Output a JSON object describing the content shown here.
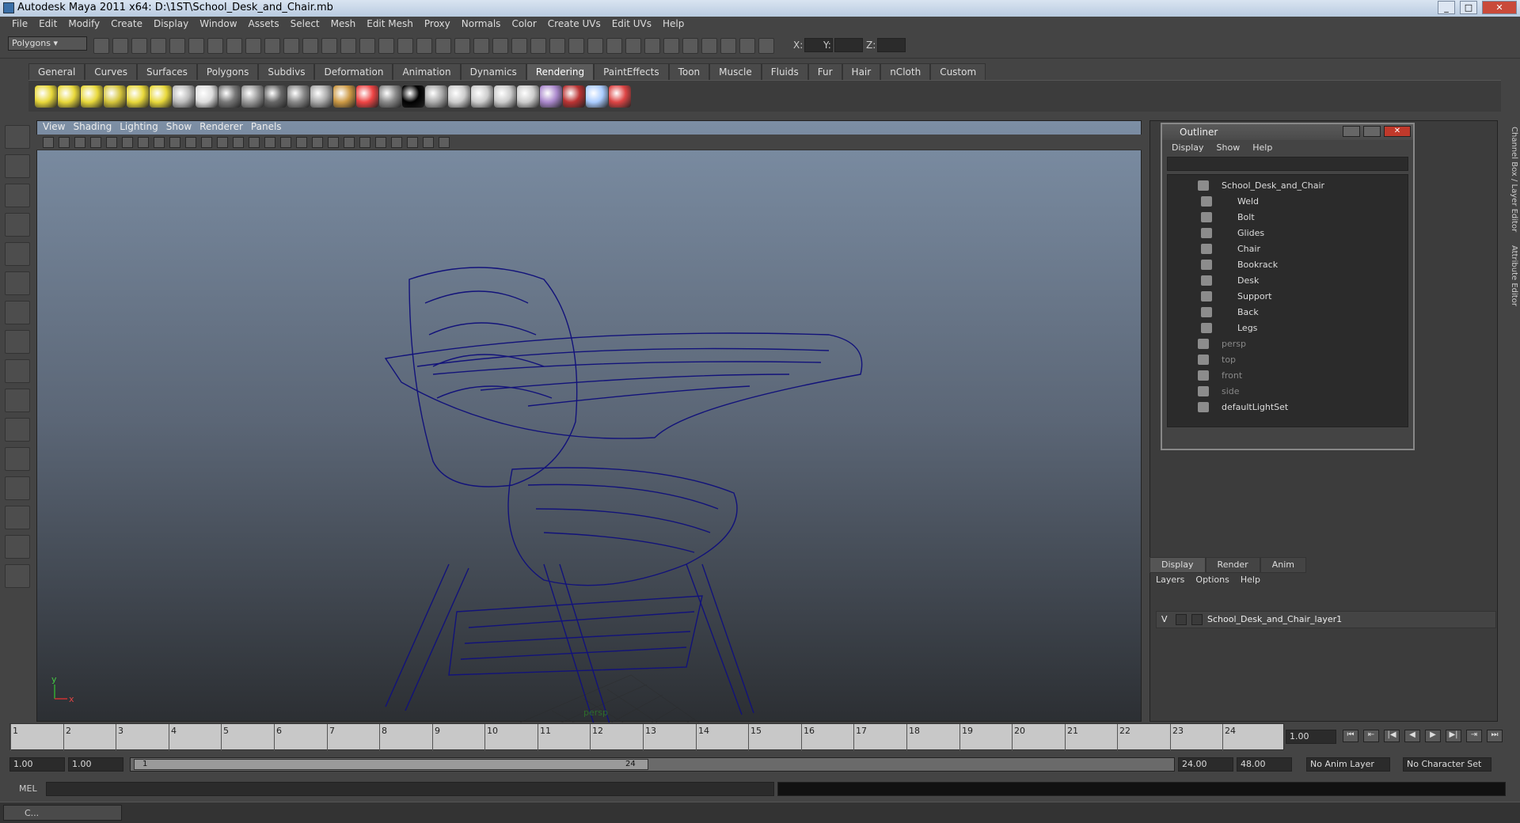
{
  "window": {
    "title": "Autodesk Maya 2011 x64: D:\\1ST\\School_Desk_and_Chair.mb"
  },
  "menubar": [
    "File",
    "Edit",
    "Modify",
    "Create",
    "Display",
    "Window",
    "Assets",
    "Select",
    "Mesh",
    "Edit Mesh",
    "Proxy",
    "Normals",
    "Color",
    "Create UVs",
    "Edit UVs",
    "Help"
  ],
  "status": {
    "mode": "Polygons",
    "x_label": "X:",
    "y_label": "Y:",
    "z_label": "Z:"
  },
  "shelf_tabs": [
    "General",
    "Curves",
    "Surfaces",
    "Polygons",
    "Subdivs",
    "Deformation",
    "Animation",
    "Dynamics",
    "Rendering",
    "PaintEffects",
    "Toon",
    "Muscle",
    "Fluids",
    "Fur",
    "Hair",
    "nCloth",
    "Custom"
  ],
  "shelf_active": "Rendering",
  "viewport": {
    "menu": [
      "View",
      "Shading",
      "Lighting",
      "Show",
      "Renderer",
      "Panels"
    ],
    "camera_label": "persp",
    "axis_x": "x",
    "axis_y": "y"
  },
  "outliner": {
    "title": "Outliner",
    "menu": [
      "Display",
      "Show",
      "Help"
    ],
    "items": [
      {
        "label": "School_Desk_and_Chair",
        "level": 0,
        "dim": false
      },
      {
        "label": "Weld",
        "level": 1,
        "dim": false
      },
      {
        "label": "Bolt",
        "level": 1,
        "dim": false
      },
      {
        "label": "Glides",
        "level": 1,
        "dim": false
      },
      {
        "label": "Chair",
        "level": 1,
        "dim": false
      },
      {
        "label": "Bookrack",
        "level": 1,
        "dim": false
      },
      {
        "label": "Desk",
        "level": 1,
        "dim": false
      },
      {
        "label": "Support",
        "level": 1,
        "dim": false
      },
      {
        "label": "Back",
        "level": 1,
        "dim": false
      },
      {
        "label": "Legs",
        "level": 1,
        "dim": false
      },
      {
        "label": "persp",
        "level": 0,
        "dim": true
      },
      {
        "label": "top",
        "level": 0,
        "dim": true
      },
      {
        "label": "front",
        "level": 0,
        "dim": true
      },
      {
        "label": "side",
        "level": 0,
        "dim": true
      },
      {
        "label": "defaultLightSet",
        "level": 0,
        "dim": false
      }
    ]
  },
  "side_tabs": {
    "channel_box": "Channel Box / Layer Editor",
    "attribute_editor": "Attribute Editor"
  },
  "layer_editor": {
    "tabs": [
      "Display",
      "Render",
      "Anim"
    ],
    "menu": [
      "Layers",
      "Options",
      "Help"
    ],
    "layer": {
      "visible": "V",
      "name": "School_Desk_and_Chair_layer1"
    }
  },
  "timeline": {
    "ticks": [
      "1",
      "2",
      "3",
      "4",
      "5",
      "6",
      "7",
      "8",
      "9",
      "10",
      "11",
      "12",
      "13",
      "14",
      "15",
      "16",
      "17",
      "18",
      "19",
      "20",
      "21",
      "22",
      "23",
      "24"
    ],
    "current_frame": "1.00"
  },
  "range": {
    "start": "1.00",
    "start2": "1.00",
    "range_start": "1",
    "range_end": "24",
    "end": "24.00",
    "end2": "48.00",
    "anim_layer": "No Anim Layer",
    "char_set": "No Character Set"
  },
  "cmdline": {
    "label": "MEL"
  },
  "taskbar": {
    "item": "C..."
  }
}
